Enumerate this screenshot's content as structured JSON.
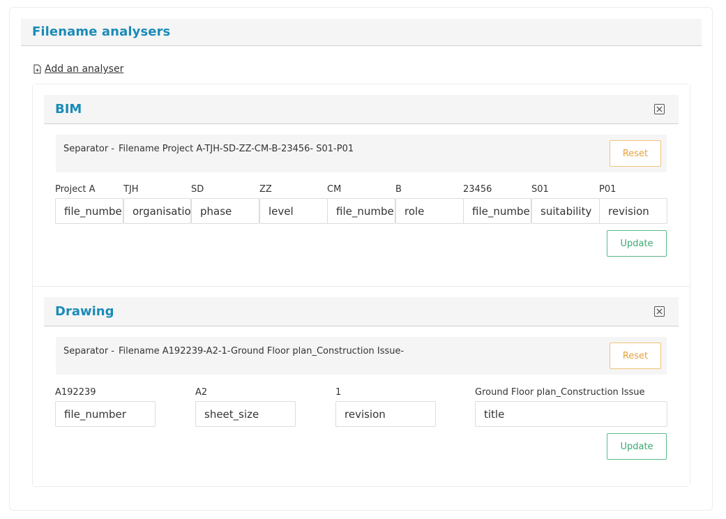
{
  "page": {
    "title": "Filename analysers",
    "add_link": "Add an analyser"
  },
  "analysers": [
    {
      "name": "BIM",
      "separator_label": "Separator -",
      "filename_text": "Filename Project A-TJH-SD-ZZ-CM-B-23456- S01-P01",
      "reset_label": "Reset",
      "update_label": "Update",
      "fields": [
        {
          "label": "Project A",
          "value": "file_number"
        },
        {
          "label": "TJH",
          "value": "organisation"
        },
        {
          "label": "SD",
          "value": "phase"
        },
        {
          "label": "ZZ",
          "value": "level"
        },
        {
          "label": "CM",
          "value": "file_number"
        },
        {
          "label": "B",
          "value": "role"
        },
        {
          "label": "23456",
          "value": "file_number"
        },
        {
          "label": "S01",
          "value": "suitability"
        },
        {
          "label": "P01",
          "value": "revision"
        }
      ]
    },
    {
      "name": "Drawing",
      "separator_label": "Separator -",
      "filename_text": "Filename A192239-A2-1-Ground Floor plan_Construction Issue-",
      "reset_label": "Reset",
      "update_label": "Update",
      "fields": [
        {
          "label": "A192239",
          "value": "file_number"
        },
        {
          "label": "A2",
          "value": "sheet_size"
        },
        {
          "label": "1",
          "value": "revision"
        },
        {
          "label": "Ground Floor plan_Construction Issue",
          "value": "title"
        }
      ]
    }
  ],
  "colors": {
    "accent": "#1a8bb8",
    "reset": "#e8a13a",
    "update": "#3aa872"
  }
}
